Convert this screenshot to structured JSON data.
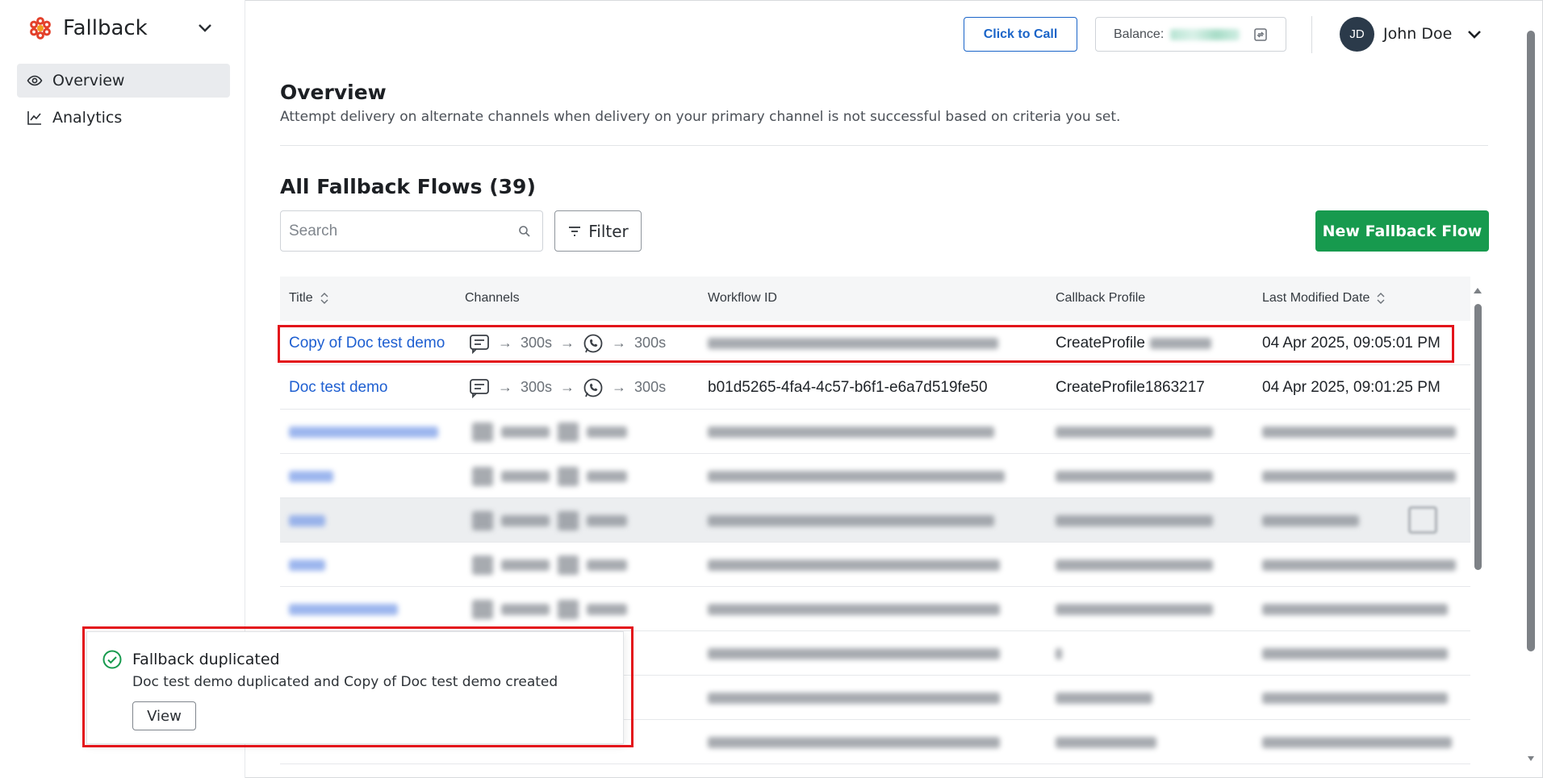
{
  "app": {
    "name": "Fallback"
  },
  "sidebar": {
    "items": [
      {
        "label": "Overview",
        "active": true
      },
      {
        "label": "Analytics",
        "active": false
      }
    ]
  },
  "topbar": {
    "call_button": "Click to Call",
    "balance_label": "Balance:",
    "user_initials": "JD",
    "user_name": "John Doe"
  },
  "page": {
    "title": "Overview",
    "description": "Attempt delivery on alternate channels when delivery on your primary channel is not successful based on criteria you set.",
    "section_title": "All Fallback Flows (39)"
  },
  "toolbar": {
    "search_placeholder": "Search",
    "filter_label": "Filter",
    "new_button": "New Fallback Flow"
  },
  "table": {
    "columns": [
      "Title",
      "Channels",
      "Workflow ID",
      "Callback Profile",
      "Last Modified Date"
    ],
    "rows": [
      {
        "title": "Copy of Doc test demo",
        "delay1": "300s",
        "delay2": "300s",
        "workflow_id": "",
        "callback_profile": "CreateProfile",
        "date": "04 Apr 2025, 09:05:01 PM"
      },
      {
        "title": "Doc test demo",
        "delay1": "300s",
        "delay2": "300s",
        "workflow_id": "b01d5265-4fa4-4c57-b6f1-e6a7d519fe50",
        "callback_profile": "CreateProfile1863217",
        "date": "04 Apr 2025, 09:01:25 PM"
      }
    ],
    "blurred_row_count": 8
  },
  "toast": {
    "title": "Fallback duplicated",
    "body": "Doc test demo duplicated and Copy of Doc test demo created",
    "button": "View",
    "status_color": "#179a4e"
  },
  "colors": {
    "accent": "#1a64c8",
    "primary_button": "#179a4e",
    "highlight": "#e3141b",
    "link": "#1e5fd1"
  }
}
